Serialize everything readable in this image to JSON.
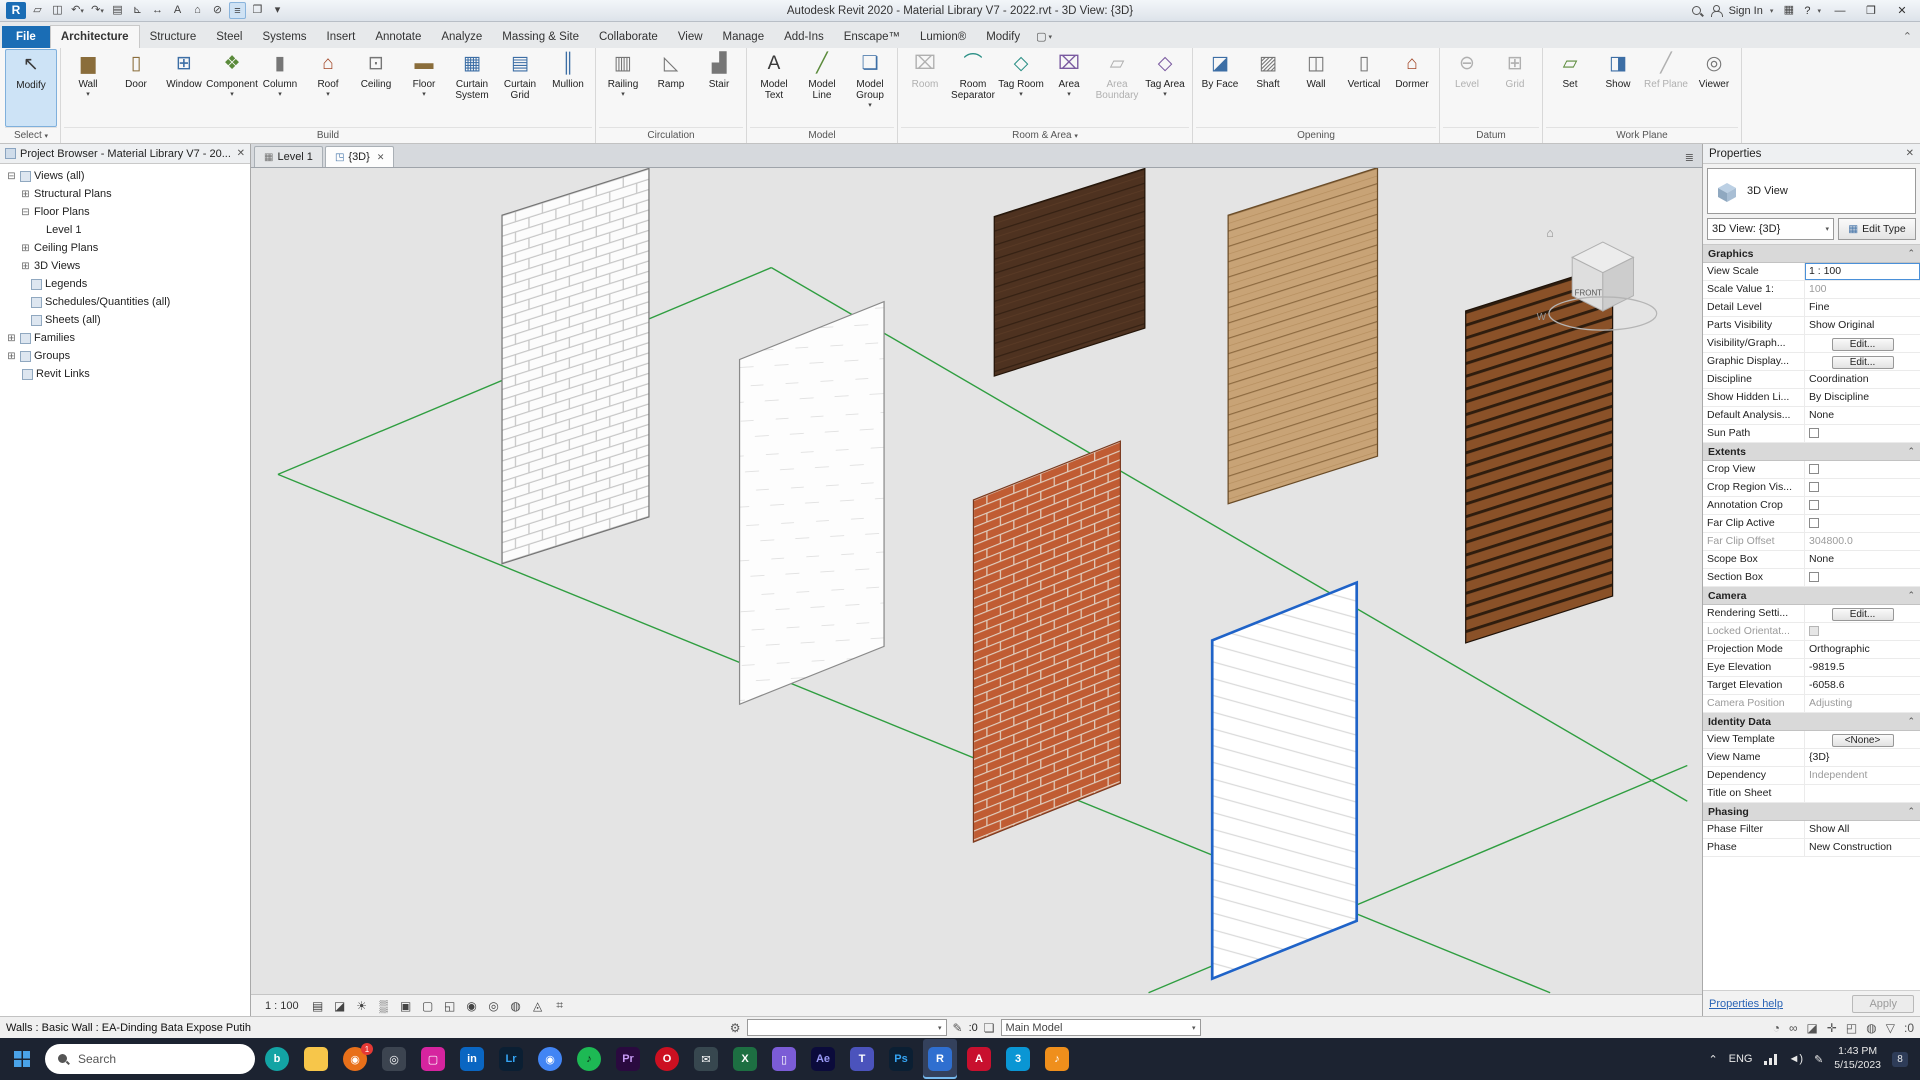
{
  "colors": {
    "selection_blue": "#1f63c8",
    "grid_green": "#2f9e40",
    "file_tab_blue": "#1a6db5",
    "taskbar_bg": "#1c2331",
    "revit_brand_blue": "#2f6fd0"
  },
  "glyphs": {
    "caret": "▾",
    "close": "✕",
    "minimize": "—",
    "maximize": "❐",
    "collapse": "⌃",
    "tab_list": "≣",
    "select_box": "▢"
  },
  "icons": {
    "modify": "↖",
    "wall": "▆",
    "door": "▯",
    "window": "⊞",
    "component": "❖",
    "column": "▮",
    "roof": "⌂",
    "ceiling": "⊡",
    "floor": "▬",
    "curtain_system": "▦",
    "curtain_grid": "▤",
    "mullion": "║",
    "railing": "▥",
    "ramp": "◺",
    "stair": "▟",
    "model_text": "A",
    "model_line": "╱",
    "model_group": "❏",
    "room": "⌧",
    "room_separator": "⌒",
    "tag_room": "◇",
    "area": "⌧",
    "area_boundary": "▱",
    "tag_area": "◇",
    "by_face": "◪",
    "shaft": "▨",
    "wall_opening": "◫",
    "vertical": "▯",
    "dormer": "⌂",
    "level": "⊖",
    "grid": "⊞",
    "set": "▱",
    "show": "◨",
    "ref_plane": "╱",
    "viewer": "◎",
    "plan_view": "▦",
    "three_d_view": "◳",
    "worksets": "⚙",
    "design_options": "❏",
    "pencil": "✎",
    "funnel": "▽",
    "edit_type": "▦"
  },
  "title_bar": {
    "app_title": "Autodesk Revit 2020 - Material Library V7 - 2022.rvt - 3D View: {3D}",
    "sign_in_label": "Sign In",
    "help_label": "?",
    "store_glyph": "▦",
    "qat": [
      {
        "name": "application-menu",
        "glyph": "R"
      },
      {
        "name": "open",
        "glyph": "▱"
      },
      {
        "name": "save",
        "glyph": "◫"
      },
      {
        "name": "undo",
        "glyph": "↶"
      },
      {
        "name": "redo",
        "glyph": "↷"
      },
      {
        "name": "print",
        "glyph": "▤"
      },
      {
        "name": "measure",
        "glyph": "⊾"
      },
      {
        "name": "aligned-dimension",
        "glyph": "↔"
      },
      {
        "name": "text",
        "glyph": "A"
      },
      {
        "name": "default-3d-view",
        "glyph": "⌂"
      },
      {
        "name": "section",
        "glyph": "⊘"
      },
      {
        "name": "thin-lines",
        "glyph": "≡"
      },
      {
        "name": "switch-windows",
        "glyph": "❐"
      },
      {
        "name": "customize-qat",
        "glyph": "▾"
      }
    ]
  },
  "ribbon_tabs": {
    "items": [
      "File",
      "Architecture",
      "Structure",
      "Steel",
      "Systems",
      "Insert",
      "Annotate",
      "Analyze",
      "Massing & Site",
      "Collaborate",
      "View",
      "Manage",
      "Add-Ins",
      "Enscape™",
      "Lumion®",
      "Modify"
    ],
    "active": "Architecture"
  },
  "ribbon": {
    "panels": [
      {
        "label": "Select",
        "arrow": true,
        "tools": [
          {
            "label": "Modify"
          }
        ]
      },
      {
        "label": "Build",
        "tools": [
          {
            "label": "Wall",
            "arrow": true
          },
          {
            "label": "Door"
          },
          {
            "label": "Window"
          },
          {
            "label": "Component",
            "arrow": true
          },
          {
            "label": "Column",
            "arrow": true
          },
          {
            "label": "Roof",
            "arrow": true
          },
          {
            "label": "Ceiling"
          },
          {
            "label": "Floor",
            "arrow": true
          },
          {
            "label": "Curtain System"
          },
          {
            "label": "Curtain Grid"
          },
          {
            "label": "Mullion"
          }
        ]
      },
      {
        "label": "Circulation",
        "tools": [
          {
            "label": "Railing",
            "arrow": true
          },
          {
            "label": "Ramp"
          },
          {
            "label": "Stair"
          }
        ]
      },
      {
        "label": "Model",
        "tools": [
          {
            "label": "Model Text"
          },
          {
            "label": "Model Line"
          },
          {
            "label": "Model Group",
            "arrow": true
          }
        ]
      },
      {
        "label": "Room & Area",
        "arrow": true,
        "tools": [
          {
            "label": "Room",
            "disabled": true
          },
          {
            "label": "Room Separator"
          },
          {
            "label": "Tag Room",
            "arrow": true
          },
          {
            "label": "Area",
            "arrow": true
          },
          {
            "label": "Area Boundary",
            "disabled": true
          },
          {
            "label": "Tag Area",
            "arrow": true
          }
        ]
      },
      {
        "label": "Opening",
        "tools": [
          {
            "label": "By Face"
          },
          {
            "label": "Shaft"
          },
          {
            "label": "Wall"
          },
          {
            "label": "Vertical"
          },
          {
            "label": "Dormer"
          }
        ]
      },
      {
        "label": "Datum",
        "tools": [
          {
            "label": "Level",
            "disabled": true
          },
          {
            "label": "Grid",
            "disabled": true
          }
        ]
      },
      {
        "label": "Work Plane",
        "tools": [
          {
            "label": "Set"
          },
          {
            "label": "Show"
          },
          {
            "label": "Ref Plane",
            "disabled": true
          },
          {
            "label": "Viewer"
          }
        ]
      }
    ]
  },
  "project_browser": {
    "title": "Project Browser - Material Library V7 - 20...",
    "items": [
      {
        "label": "Views (all)",
        "level": 0,
        "expander": "⊟",
        "icon": true
      },
      {
        "label": "Structural Plans",
        "level": 1,
        "expander": "⊞"
      },
      {
        "label": "Floor Plans",
        "level": 1,
        "expander": "⊟"
      },
      {
        "label": "Level 1",
        "level": 2,
        "expander": ""
      },
      {
        "label": "Ceiling Plans",
        "level": 1,
        "expander": "⊞"
      },
      {
        "label": "3D Views",
        "level": 1,
        "expander": "⊞"
      },
      {
        "label": "Legends",
        "level": 1,
        "expander": "",
        "icon": true
      },
      {
        "label": "Schedules/Quantities (all)",
        "level": 1,
        "expander": "",
        "icon": true
      },
      {
        "label": "Sheets (all)",
        "level": 1,
        "expander": "",
        "icon": true
      },
      {
        "label": "Families",
        "level": 0,
        "expander": "⊞",
        "icon": true
      },
      {
        "label": "Groups",
        "level": 0,
        "expander": "⊞",
        "icon": true
      },
      {
        "label": "Revit Links",
        "level": 0,
        "expander": "",
        "icon": true
      }
    ]
  },
  "view_tabs": {
    "items": [
      {
        "label": "Level 1",
        "active": false
      },
      {
        "label": "{3D}",
        "active": true
      }
    ]
  },
  "viewport": {
    "view_cube": {
      "front": "FRONT",
      "west": "W",
      "home": "⌂"
    },
    "walls": [
      "white-brick-wall",
      "dark-wood-wall",
      "light-wood-plank-wall",
      "wood-slat-wall",
      "white-panel-wall",
      "red-brick-wall",
      "selected-white-brick-wall"
    ]
  },
  "view_controls": {
    "scale": "1 : 100",
    "icons": [
      {
        "name": "detail-level",
        "glyph": "▤"
      },
      {
        "name": "visual-style",
        "glyph": "◪"
      },
      {
        "name": "sun-path",
        "glyph": "☀"
      },
      {
        "name": "shadows",
        "glyph": "▒"
      },
      {
        "name": "rendering-dialog",
        "glyph": "▣"
      },
      {
        "name": "crop-view",
        "glyph": "▢"
      },
      {
        "name": "show-crop-region",
        "glyph": "◱"
      },
      {
        "name": "temporary-hide-isolate",
        "glyph": "◉"
      },
      {
        "name": "reveal-hidden-elements",
        "glyph": "◎"
      },
      {
        "name": "worksharing-display",
        "glyph": "◍"
      },
      {
        "name": "temporary-view-properties",
        "glyph": "◬"
      },
      {
        "name": "analytical-model",
        "glyph": "⌗"
      }
    ]
  },
  "properties": {
    "panel_title": "Properties",
    "type_name": "3D View",
    "selector_value": "3D View: {3D}",
    "edit_type_label": "Edit Type",
    "help_link": "Properties help",
    "apply_label": "Apply",
    "sections": [
      {
        "title": "Graphics",
        "rows": [
          {
            "label": "View Scale",
            "value": "1 : 100",
            "kind": "focus"
          },
          {
            "label": "Scale Value    1:",
            "value": "100",
            "kind": "text",
            "gray": true
          },
          {
            "label": "Detail Level",
            "value": "Fine",
            "kind": "text"
          },
          {
            "label": "Parts Visibility",
            "value": "Show Original",
            "kind": "text"
          },
          {
            "label": "Visibility/Graph...",
            "value": "Edit...",
            "kind": "button"
          },
          {
            "label": "Graphic Display...",
            "value": "Edit...",
            "kind": "button"
          },
          {
            "label": "Discipline",
            "value": "Coordination",
            "kind": "text"
          },
          {
            "label": "Show Hidden Li...",
            "value": "By Discipline",
            "kind": "text"
          },
          {
            "label": "Default Analysis...",
            "value": "None",
            "kind": "text"
          },
          {
            "label": "Sun Path",
            "value": "",
            "kind": "checkbox"
          }
        ]
      },
      {
        "title": "Extents",
        "rows": [
          {
            "label": "Crop View",
            "value": "",
            "kind": "checkbox"
          },
          {
            "label": "Crop Region Vis...",
            "value": "",
            "kind": "checkbox"
          },
          {
            "label": "Annotation Crop",
            "value": "",
            "kind": "checkbox"
          },
          {
            "label": "Far Clip Active",
            "value": "",
            "kind": "checkbox"
          },
          {
            "label": "Far Clip Offset",
            "value": "304800.0",
            "kind": "text",
            "gray": true
          },
          {
            "label": "Scope Box",
            "value": "None",
            "kind": "text"
          },
          {
            "label": "Section Box",
            "value": "",
            "kind": "checkbox"
          }
        ]
      },
      {
        "title": "Camera",
        "rows": [
          {
            "label": "Rendering Setti...",
            "value": "Edit...",
            "kind": "button"
          },
          {
            "label": "Locked Orientat...",
            "value": "",
            "kind": "checkbox",
            "gray": true
          },
          {
            "label": "Projection Mode",
            "value": "Orthographic",
            "kind": "text"
          },
          {
            "label": "Eye Elevation",
            "value": "-9819.5",
            "kind": "text"
          },
          {
            "label": "Target Elevation",
            "value": "-6058.6",
            "kind": "text"
          },
          {
            "label": "Camera Position",
            "value": "Adjusting",
            "kind": "text",
            "gray": true
          }
        ]
      },
      {
        "title": "Identity Data",
        "rows": [
          {
            "label": "View Template",
            "value": "<None>",
            "kind": "button"
          },
          {
            "label": "View Name",
            "value": "{3D}",
            "kind": "text"
          },
          {
            "label": "Dependency",
            "value": "Independent",
            "kind": "text",
            "gray": true
          },
          {
            "label": "Title on Sheet",
            "value": "",
            "kind": "text"
          }
        ]
      },
      {
        "title": "Phasing",
        "rows": [
          {
            "label": "Phase Filter",
            "value": "Show All",
            "kind": "text"
          },
          {
            "label": "Phase",
            "value": "New Construction",
            "kind": "text"
          }
        ]
      }
    ]
  },
  "status_bar": {
    "selection_info": "Walls : Basic Wall : EA-Dinding Bata Expose Putih",
    "workset_value": "",
    "editing_requests": ":0",
    "design_option": "Main Model",
    "filter_count": ":0",
    "toggles": [
      {
        "name": "background-processes",
        "glyph": "◔"
      },
      {
        "name": "select-links-toggle",
        "glyph": "∞"
      },
      {
        "name": "select-underlay-toggle",
        "glyph": "◪"
      },
      {
        "name": "select-pinned-toggle",
        "glyph": "✛"
      },
      {
        "name": "select-by-face-toggle",
        "glyph": "◰"
      },
      {
        "name": "drag-on-selection-toggle",
        "glyph": "◍"
      }
    ]
  },
  "taskbar": {
    "search_placeholder": "Search",
    "apps": [
      {
        "name": "bing",
        "label": "b",
        "bg": "#13a4a4",
        "color": "#ffffff"
      },
      {
        "name": "file-explorer",
        "label": "",
        "bg": "#f7c64a",
        "color": "#9a7318"
      },
      {
        "name": "firefox",
        "label": "◉",
        "bg": "#e8701a",
        "color": "#ffffff",
        "badge": "1"
      },
      {
        "name": "obs",
        "label": "◎",
        "bg": "#3c4450",
        "color": "#ffffff"
      },
      {
        "name": "instagram",
        "label": "▢",
        "bg": "#d6249f",
        "color": "#ffffff"
      },
      {
        "name": "linkedin",
        "label": "in",
        "bg": "#0a66c2",
        "color": "#ffffff"
      },
      {
        "name": "lightroom",
        "label": "Lr",
        "bg": "#0b1f33",
        "color": "#35a4f3"
      },
      {
        "name": "chrome",
        "label": "◉",
        "bg": "#4285f4",
        "color": "#ffffff"
      },
      {
        "name": "spotify",
        "label": "♪",
        "bg": "#1db954",
        "color": "#0b2b16"
      },
      {
        "name": "premiere",
        "label": "Pr",
        "bg": "#2a0a3f",
        "color": "#c89bf5"
      },
      {
        "name": "opera",
        "label": "O",
        "bg": "#cc1021",
        "color": "#ffffff"
      },
      {
        "name": "mail",
        "label": "✉",
        "bg": "#37474f",
        "color": "#ffffff"
      },
      {
        "name": "excel",
        "label": "X",
        "bg": "#1d6f42",
        "color": "#ffffff"
      },
      {
        "name": "phone-link",
        "label": "▯",
        "bg": "#7b5cd6",
        "color": "#ffffff"
      },
      {
        "name": "after-effects",
        "label": "Ae",
        "bg": "#0b0b3b",
        "color": "#9a9af5"
      },
      {
        "name": "teams",
        "label": "T",
        "bg": "#4b53bc",
        "color": "#ffffff"
      },
      {
        "name": "photoshop",
        "label": "Ps",
        "bg": "#0b1f33",
        "color": "#35a4f3"
      },
      {
        "name": "revit",
        "label": "R",
        "bg": "#2f6fd0",
        "color": "#ffffff",
        "active": true
      },
      {
        "name": "autocad",
        "label": "A",
        "bg": "#c8102e",
        "color": "#ffffff"
      },
      {
        "name": "3ds-max",
        "label": "3",
        "bg": "#0a96d4",
        "color": "#ffffff"
      },
      {
        "name": "groove-music",
        "label": "♪",
        "bg": "#ef8f1c",
        "color": "#ffffff"
      }
    ],
    "tray": {
      "chevron": "⌃",
      "language": "ENG",
      "pen": "✎",
      "volume": "◄)",
      "time": "1:43 PM",
      "date": "5/15/2023",
      "notification_count": "8"
    }
  }
}
